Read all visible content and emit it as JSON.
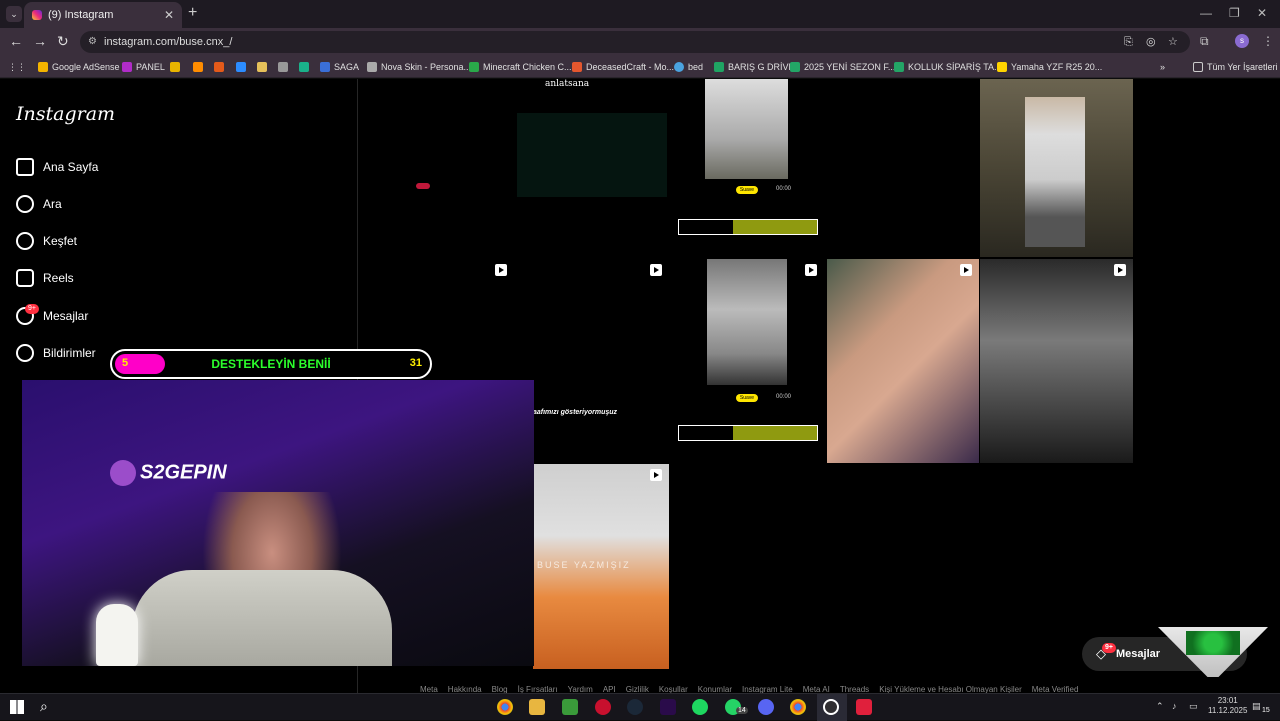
{
  "browser": {
    "tab_title": "(9) Instagram",
    "url": "instagram.com/buse.cnx_/",
    "profile_initial": "s",
    "bookmarks": [
      "Google AdSense",
      "PANEL",
      "SAGA",
      "Nova Skin - Persona...",
      "Minecraft Chicken C...",
      "DeceasedCraft - Mo...",
      "bed",
      "BARIŞ G DRİVE",
      "2025 YENİ SEZON F...",
      "KOLLUK SİPARİŞ TA...",
      "Yamaha YZF R25 20..."
    ],
    "all_bookmarks": "Tüm Yer İşaretleri"
  },
  "sidebar": {
    "logo": "Instagram",
    "items": [
      {
        "label": "Ana Sayfa",
        "icon": "home-icon"
      },
      {
        "label": "Ara",
        "icon": "search-icon"
      },
      {
        "label": "Keşfet",
        "icon": "compass-icon"
      },
      {
        "label": "Reels",
        "icon": "reels-icon"
      },
      {
        "label": "Mesajlar",
        "icon": "messenger-icon"
      },
      {
        "label": "Bildirimler",
        "icon": "heart-icon"
      }
    ],
    "messages_badge": "9+"
  },
  "grid": {
    "captions": [
      "anlatsana",
      "aafımızı gösteriyormuşuz",
      "BUSE YAZMIŞIZ"
    ],
    "timeline_label": "Suave",
    "timecode": "00:00"
  },
  "overlay": {
    "donation_current": "5",
    "donation_label": "DESTEKLEYİN BENİİ",
    "donation_goal": "31",
    "donation_fraction": 0.16,
    "brand": "S2GEPIN"
  },
  "footer": [
    "Meta",
    "Hakkında",
    "Blog",
    "İş Fırsatları",
    "Yardım",
    "API",
    "Gizlilik",
    "Koşullar",
    "Konumlar",
    "Instagram Lite",
    "Meta AI",
    "Threads",
    "Kişi Yükleme ve Hesabı Olmayan Kişiler",
    "Meta Verified"
  ],
  "messages_pill": {
    "label": "Mesajlar",
    "badge": "9+"
  },
  "taskbar": {
    "time": "23:01",
    "date": "11.12.2025",
    "whatsapp_badge": "14",
    "notif_count": "15"
  }
}
